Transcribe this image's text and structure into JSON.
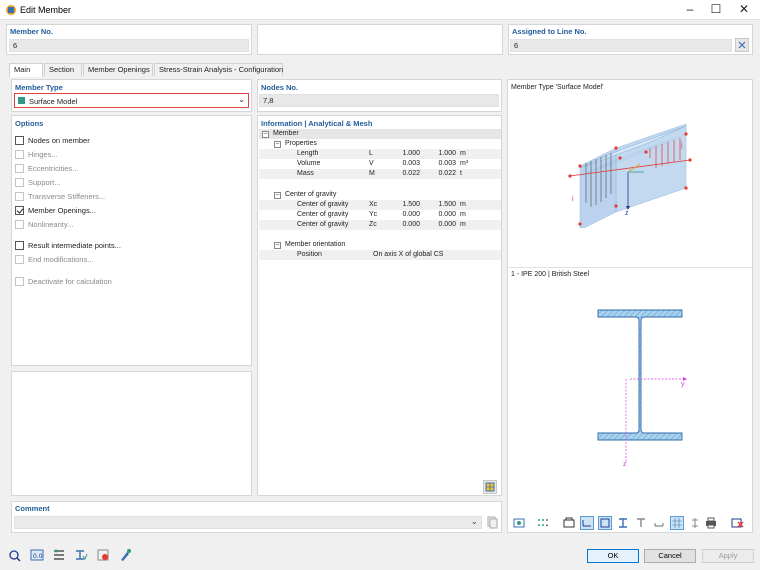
{
  "window": {
    "title": "Edit Member"
  },
  "header": {
    "member_no_label": "Member No.",
    "member_no_value": "6",
    "assigned_label": "Assigned to Line No.",
    "assigned_value": "6"
  },
  "tabs": [
    "Main",
    "Section",
    "Member Openings",
    "Stress-Strain Analysis - Configuration"
  ],
  "member_type": {
    "label": "Member Type",
    "value": "Surface Model",
    "swatch_color": "#2e9a86"
  },
  "nodes": {
    "label": "Nodes No.",
    "value": "7,8"
  },
  "options": {
    "label": "Options",
    "items": [
      {
        "label": "Nodes on member",
        "checked": false,
        "enabled": true
      },
      {
        "label": "Hinges...",
        "checked": false,
        "enabled": false
      },
      {
        "label": "Eccentricities...",
        "checked": false,
        "enabled": false
      },
      {
        "label": "Support...",
        "checked": false,
        "enabled": false
      },
      {
        "label": "Transverse Stiffeners...",
        "checked": false,
        "enabled": false
      },
      {
        "label": "Member Openings...",
        "checked": true,
        "enabled": true
      },
      {
        "label": "Nonlinearity...",
        "checked": false,
        "enabled": false
      },
      {
        "label": "Result intermediate points...",
        "checked": false,
        "enabled": true
      },
      {
        "label": "End modifications...",
        "checked": false,
        "enabled": false
      },
      {
        "label": "Deactivate for calculation",
        "checked": false,
        "enabled": false
      }
    ]
  },
  "info": {
    "label": "Information | Analytical & Mesh",
    "root": "Member",
    "properties": {
      "label": "Properties",
      "rows": [
        {
          "name": "Length",
          "sym": "L",
          "v1": "1.000",
          "v2": "1.000",
          "unit": "m"
        },
        {
          "name": "Volume",
          "sym": "V",
          "v1": "0.003",
          "v2": "0.003",
          "unit": "m³"
        },
        {
          "name": "Mass",
          "sym": "M",
          "v1": "0.022",
          "v2": "0.022",
          "unit": "t"
        }
      ]
    },
    "center": {
      "label": "Center of gravity",
      "rows": [
        {
          "name": "Center of gravity",
          "sym": "Xc",
          "v1": "1.500",
          "v2": "1.500",
          "unit": "m"
        },
        {
          "name": "Center of gravity",
          "sym": "Yc",
          "v1": "0.000",
          "v2": "0.000",
          "unit": "m"
        },
        {
          "name": "Center of gravity",
          "sym": "Zc",
          "v1": "0.000",
          "v2": "0.000",
          "unit": "m"
        }
      ]
    },
    "orientation": {
      "label": "Member orientation",
      "position_label": "Position",
      "position_value": "On axis X of global CS"
    }
  },
  "preview": {
    "model_label": "Member Type 'Surface Model'",
    "section_label": "1 - IPE 200 | British Steel"
  },
  "comment": {
    "label": "Comment",
    "value": ""
  },
  "buttons": {
    "ok": "OK",
    "cancel": "Cancel",
    "apply": "Apply"
  }
}
